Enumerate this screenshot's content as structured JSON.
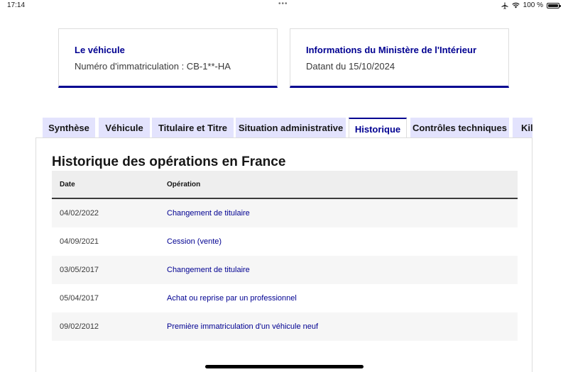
{
  "status_bar": {
    "time": "17:14",
    "dots": "•••",
    "battery": "100 %"
  },
  "cards": [
    {
      "title": "Le véhicule",
      "text": "Numéro d'immatriculation : CB-1**-HA"
    },
    {
      "title": "Informations du Ministère de l'Intérieur",
      "text": "Datant du 15/10/2024"
    }
  ],
  "tabs": [
    {
      "label": "Synthèse"
    },
    {
      "label": "Véhicule"
    },
    {
      "label": "Titulaire et Titre"
    },
    {
      "label": "Situation administrative"
    },
    {
      "label": "Historique",
      "active": true
    },
    {
      "label": "Contrôles techniques"
    },
    {
      "label": "Kilométrage"
    }
  ],
  "history": {
    "title": "Historique des opérations en France",
    "headers": {
      "date": "Date",
      "operation": "Opération"
    },
    "rows": [
      {
        "date": "04/02/2022",
        "operation": "Changement de titulaire"
      },
      {
        "date": "04/09/2021",
        "operation": "Cession (vente)"
      },
      {
        "date": "03/05/2017",
        "operation": "Changement de titulaire"
      },
      {
        "date": "05/04/2017",
        "operation": "Achat ou reprise par un professionnel"
      },
      {
        "date": "09/02/2012",
        "operation": "Première immatriculation d'un véhicule neuf"
      }
    ]
  },
  "colors": {
    "accent": "#000091",
    "tab_background": "#e3e3fd"
  }
}
